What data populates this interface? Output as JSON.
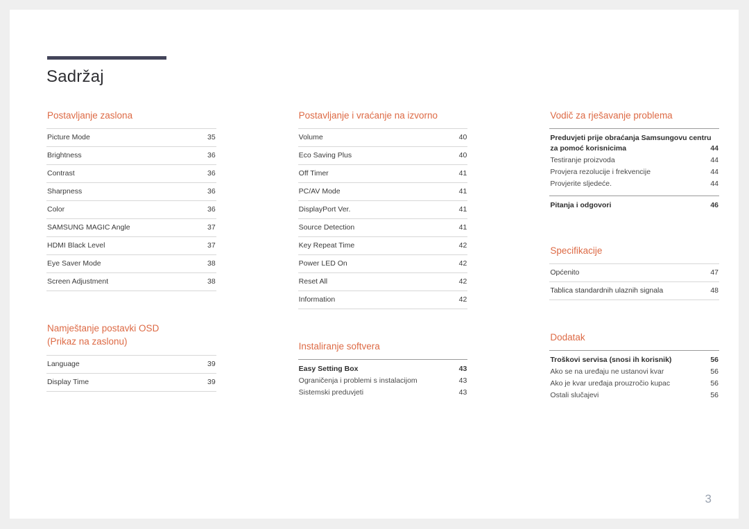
{
  "document": {
    "title": "Sadržaj",
    "page_number": "3",
    "accent_color": "#dd6a45",
    "rule_color": "#43445a"
  },
  "columns": [
    {
      "sections": [
        {
          "title": "Postavljanje zaslona",
          "style": "ruled",
          "entries": [
            {
              "label": "Picture Mode",
              "page": "35"
            },
            {
              "label": "Brightness",
              "page": "36"
            },
            {
              "label": "Contrast",
              "page": "36"
            },
            {
              "label": "Sharpness",
              "page": "36"
            },
            {
              "label": "Color",
              "page": "36"
            },
            {
              "label": "SAMSUNG MAGIC Angle",
              "page": "37"
            },
            {
              "label": "HDMI Black Level",
              "page": "37"
            },
            {
              "label": "Eye Saver Mode",
              "page": "38"
            },
            {
              "label": "Screen Adjustment",
              "page": "38"
            }
          ]
        },
        {
          "title": "Namještanje postavki OSD (Prikaz na zaslonu)",
          "title_line1": "Namještanje postavki OSD",
          "title_line2": "(Prikaz na zaslonu)",
          "style": "ruled",
          "entries": [
            {
              "label": "Language",
              "page": "39"
            },
            {
              "label": "Display Time",
              "page": "39"
            }
          ]
        }
      ]
    },
    {
      "sections": [
        {
          "title": "Postavljanje i vraćanje na izvorno",
          "style": "ruled",
          "entries": [
            {
              "label": "Volume",
              "page": "40"
            },
            {
              "label": "Eco Saving Plus",
              "page": "40"
            },
            {
              "label": "Off Timer",
              "page": "41"
            },
            {
              "label": "PC/AV Mode",
              "page": "41"
            },
            {
              "label": "DisplayPort Ver.",
              "page": "41"
            },
            {
              "label": "Source Detection",
              "page": "41"
            },
            {
              "label": "Key Repeat Time",
              "page": "42"
            },
            {
              "label": "Power LED On",
              "page": "42"
            },
            {
              "label": "Reset All",
              "page": "42"
            },
            {
              "label": "Information",
              "page": "42"
            }
          ]
        },
        {
          "title": "Instaliranje softvera",
          "style": "grouped",
          "groups": [
            {
              "head": {
                "label": "Easy Setting Box",
                "page": "43"
              },
              "subs": [
                {
                  "label": "Ograničenja i problemi s instalacijom",
                  "page": "43"
                },
                {
                  "label": "Sistemski preduvjeti",
                  "page": "43"
                }
              ]
            }
          ]
        }
      ]
    },
    {
      "sections": [
        {
          "title": "Vodič za rješavanje problema",
          "style": "grouped",
          "groups": [
            {
              "head_wrapped": {
                "line1": "Preduvjeti prije obraćanja Samsungovu centru",
                "line2": "za pomoć korisnicima",
                "page": "44"
              },
              "subs": [
                {
                  "label": "Testiranje proizvoda",
                  "page": "44"
                },
                {
                  "label": "Provjera rezolucije i frekvencije",
                  "page": "44"
                },
                {
                  "label": "Provjerite sljedeće.",
                  "page": "44"
                }
              ]
            },
            {
              "head": {
                "label": "Pitanja i odgovori",
                "page": "46"
              },
              "subs": []
            }
          ]
        },
        {
          "title": "Specifikacije",
          "style": "ruled",
          "entries": [
            {
              "label": "Općenito",
              "page": "47"
            },
            {
              "label": "Tablica standardnih ulaznih signala",
              "page": "48"
            }
          ]
        },
        {
          "title": "Dodatak",
          "style": "grouped",
          "groups": [
            {
              "head": {
                "label": "Troškovi servisa (snosi ih korisnik)",
                "page": "56"
              },
              "subs": [
                {
                  "label": "Ako se na uređaju ne ustanovi kvar",
                  "page": "56"
                },
                {
                  "label": "Ako je kvar uređaja prouzročio kupac",
                  "page": "56"
                },
                {
                  "label": "Ostali slučajevi",
                  "page": "56"
                }
              ]
            }
          ]
        }
      ]
    }
  ]
}
